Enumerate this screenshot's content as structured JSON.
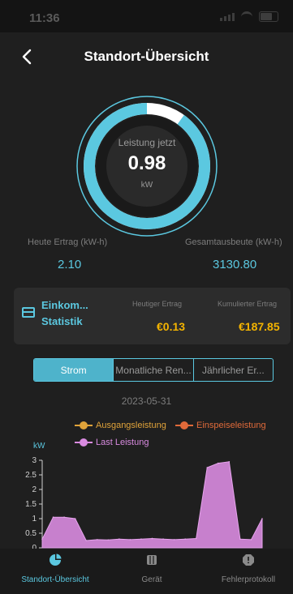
{
  "status_bar": {
    "time": "11:36"
  },
  "header": {
    "title": "Standort-Übersicht"
  },
  "gauge": {
    "label": "Leistung jetzt",
    "value": "0.98",
    "unit": "kW",
    "fill_fraction": 0.9
  },
  "stats": {
    "today_label": "Heute Ertrag (kW-h)",
    "today_value": "2.10",
    "total_label": "Gesamtausbeute (kW-h)",
    "total_value": "3130.80"
  },
  "income_card": {
    "title_line1": "Einkom...",
    "title_line2": "Statistik",
    "today_label": "Heutiger Ertrag",
    "today_value": "€0.13",
    "cumulative_label": "Kumulierter Ertrag",
    "cumulative_value": "€187.85"
  },
  "tabs": [
    "Strom",
    "Monatliche Ren...",
    "Jährlicher Er..."
  ],
  "selected_tab": 0,
  "date": "2023-05-31",
  "colors": {
    "accent": "#5bc8e0",
    "money": "#f4b400",
    "orange": "#e0a33a",
    "red_orange": "#e06a3a",
    "pink": "#d98be0"
  },
  "chart_data": {
    "type": "area",
    "ylabel": "kW",
    "ylim": [
      0,
      3
    ],
    "y_ticks": [
      "3",
      "2.5",
      "2",
      "1.5",
      "1",
      "0.5",
      "0"
    ],
    "legend": [
      "Ausgangsleistung",
      "Einspeiseleistung",
      "Last Leistung"
    ],
    "series": [
      {
        "name": "Last Leistung",
        "values": [
          0.3,
          1.05,
          1.05,
          1.0,
          0.25,
          0.28,
          0.27,
          0.3,
          0.28,
          0.3,
          0.32,
          0.3,
          0.28,
          0.3,
          0.32,
          2.75,
          2.9,
          2.95,
          0.3,
          0.28,
          1.0
        ]
      }
    ]
  },
  "bottom_nav": [
    {
      "label": "Standort-Übersicht"
    },
    {
      "label": "Gerät"
    },
    {
      "label": "Fehlerprotokoll"
    }
  ]
}
